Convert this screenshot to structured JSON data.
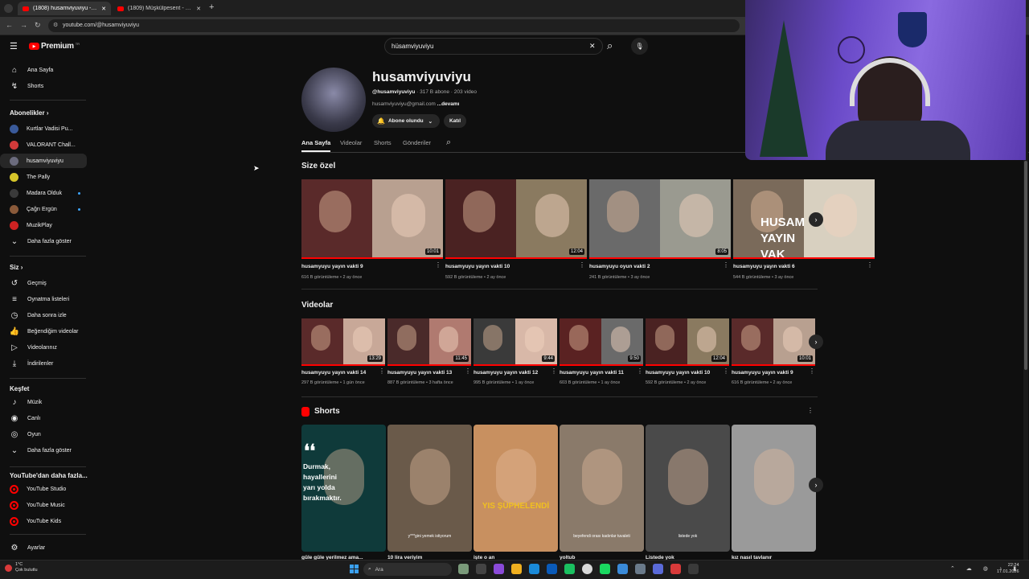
{
  "browser": {
    "tabs": [
      {
        "title": "(1808) husamviyuviyu - YouTube",
        "active": true
      },
      {
        "title": "(1809) Müşkülpesent - YouTube",
        "active": false
      }
    ],
    "new_tab": "+",
    "url": "youtube.com/@husamviyuviyu"
  },
  "header": {
    "logo": "Premium",
    "logo_sup": "TR",
    "search_value": "hüsamviyuviyu",
    "clear_icon": "✕",
    "search_icon": "⌕",
    "mic_icon": "🎙"
  },
  "sidebar": {
    "top": [
      {
        "label": "Ana Sayfa",
        "icon": "home-icon",
        "glyph": "⌂"
      },
      {
        "label": "Shorts",
        "icon": "shorts-icon",
        "glyph": "↯"
      }
    ],
    "subs_heading": "Abonelikler",
    "subs": [
      {
        "label": "Kurtlar Vadisi Pu...",
        "color": "#3a5a9a",
        "badge": "live"
      },
      {
        "label": "VALORANT Chall...",
        "color": "#d13a3a",
        "badge": "live"
      },
      {
        "label": "husamviyuviyu",
        "color": "#6b6b7d",
        "badge": "",
        "selected": true
      },
      {
        "label": "The Pally",
        "color": "#d6c52a",
        "badge": ""
      },
      {
        "label": "Madara Olduk",
        "color": "#3a3a3a",
        "badge": "dot"
      },
      {
        "label": "Çağrı Ergün",
        "color": "#8a5a3a",
        "badge": "dot"
      },
      {
        "label": "MuzikPlay",
        "color": "#cc2222",
        "badge": ""
      },
      {
        "label": "Daha fazla göster",
        "color": "",
        "badge": "",
        "chevron": true
      }
    ],
    "you_heading": "Siz",
    "you": [
      {
        "label": "Geçmiş",
        "icon": "history-icon",
        "glyph": "↺"
      },
      {
        "label": "Oynatma listeleri",
        "icon": "playlists-icon",
        "glyph": "≡"
      },
      {
        "label": "Daha sonra izle",
        "icon": "watch-later-icon",
        "glyph": "◷"
      },
      {
        "label": "Beğendiğim videolar",
        "icon": "like-icon",
        "glyph": "👍"
      },
      {
        "label": "Videolarınız",
        "icon": "your-videos-icon",
        "glyph": "▷"
      },
      {
        "label": "İndirilenler",
        "icon": "downloads-icon",
        "glyph": "⤓"
      }
    ],
    "explore_heading": "Keşfet",
    "explore": [
      {
        "label": "Müzik",
        "icon": "music-icon",
        "glyph": "♪"
      },
      {
        "label": "Canlı",
        "icon": "live-icon",
        "glyph": "◉"
      },
      {
        "label": "Oyun",
        "icon": "gaming-icon",
        "glyph": "◎"
      },
      {
        "label": "Daha fazla göster",
        "icon": "chevron-down-icon",
        "glyph": "⌄"
      }
    ],
    "more_heading": "YouTube'dan daha fazla...",
    "more": [
      {
        "label": "YouTube Studio"
      },
      {
        "label": "YouTube Music"
      },
      {
        "label": "YouTube Kids"
      }
    ],
    "settings": "Ayarlar"
  },
  "channel": {
    "name": "husamviyuviyu",
    "handle": "@husamviyuviyu",
    "stats": "· 317 B abone · 203 video",
    "email": "husamviyuviyu@gmail.com",
    "more": "...devamı",
    "subscribed": "Abone olundu",
    "join": "Katıl",
    "tabs": [
      "Ana Sayfa",
      "Videolar",
      "Shorts",
      "Gönderiler"
    ]
  },
  "for_you": {
    "title": "Size özel",
    "items": [
      {
        "title": "husamyuyu yayın vakti 9",
        "meta": "616 B görüntüleme • 2 ay önce",
        "duration": "10:01",
        "c1": "#5a2a2a",
        "c2": "#b8a090"
      },
      {
        "title": "husamyuyu yayın vakti 10",
        "meta": "592 B görüntüleme • 2 ay önce",
        "duration": "12:04",
        "c1": "#4a2222",
        "c2": "#8a7a60"
      },
      {
        "title": "husamyuyu oyun vakti 2",
        "meta": "241 B görüntüleme • 3 ay önce",
        "duration": "8:05",
        "c1": "#6a6a6a",
        "c2": "#9a9a90"
      },
      {
        "title": "husamyuyu yayın vakti 6",
        "meta": "544 B görüntüleme • 3 ay önce",
        "duration": "",
        "c1": "#7a6a5a",
        "c2": "#d8d0c0",
        "overlay": "HUSAM YAYIN VAK"
      }
    ]
  },
  "videos": {
    "title": "Videolar",
    "items": [
      {
        "title": "husamyuyu yayın vakti 14",
        "meta": "297 B görüntüleme • 1 gün önce",
        "duration": "13:29"
      },
      {
        "title": "husamyuyu yayın vakti 13",
        "meta": "887 B görüntüleme • 3 hafta önce",
        "duration": "11:45"
      },
      {
        "title": "husamyuyu yayın vakti 12",
        "meta": "995 B görüntüleme • 1 ay önce",
        "duration": "9:44"
      },
      {
        "title": "husamyuyu yayın vakti 11",
        "meta": "603 B görüntüleme • 1 ay önce",
        "duration": "9:50"
      },
      {
        "title": "husamyuyu yayın vakti 10",
        "meta": "592 B görüntüleme • 2 ay önce",
        "duration": "12:04"
      },
      {
        "title": "husamyuyu yayın vakti 9",
        "meta": "616 B görüntüleme • 2 ay önce",
        "duration": "10:01"
      }
    ]
  },
  "shorts": {
    "title": "Shorts",
    "items": [
      {
        "title": "güle güle yerilmez ama...",
        "text": "Durmak, hayallerini yarı yolda bırakmaktır.",
        "quote": "❛❛"
      },
      {
        "title": "10 lira veriyim",
        "text": "y***gini yemek istiyorum"
      },
      {
        "title": "işte o an",
        "text": "YIS ŞÜPHELENDİ"
      },
      {
        "title": "yoltub",
        "text": "beyefendi orası kadınlar tuvaleti"
      },
      {
        "title": "Listede yok",
        "text": "listede yok"
      },
      {
        "title": "kız nasıl tavlanır",
        "text": ""
      }
    ]
  },
  "taskbar": {
    "weather_temp": "1°C",
    "weather_desc": "Çok bulutlu",
    "search": "Ara",
    "time": "22:24",
    "date": "17.01.2026"
  }
}
